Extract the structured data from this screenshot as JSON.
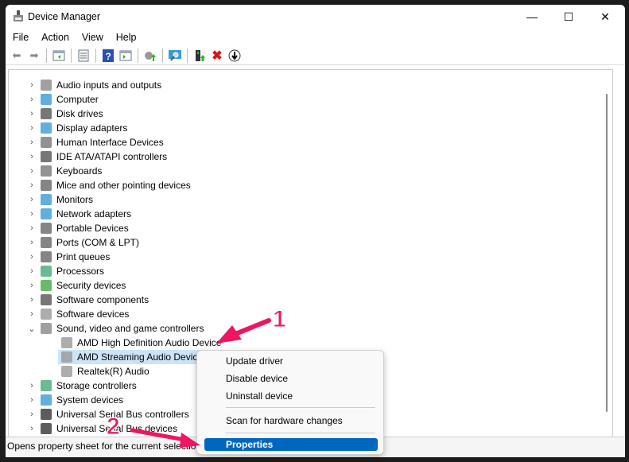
{
  "window": {
    "title": "Device Manager"
  },
  "menu": [
    "File",
    "Action",
    "View",
    "Help"
  ],
  "toolbar": {
    "icons": [
      "back-arrow-icon",
      "forward-arrow-icon",
      "show-hide-console-tree-icon",
      "properties-icon",
      "help-icon",
      "action-pane-icon",
      "update-driver-icon",
      "scan-hardware-icon",
      "enable-device-icon",
      "uninstall-device-icon",
      "disable-device-icon"
    ]
  },
  "tree": {
    "categories": [
      "Audio inputs and outputs",
      "Computer",
      "Disk drives",
      "Display adapters",
      "Human Interface Devices",
      "IDE ATA/ATAPI controllers",
      "Keyboards",
      "Mice and other pointing devices",
      "Monitors",
      "Network adapters",
      "Portable Devices",
      "Ports (COM & LPT)",
      "Print queues",
      "Processors",
      "Security devices",
      "Software components",
      "Software devices",
      "Sound, video and game controllers"
    ],
    "sound_children": [
      "AMD High Definition Audio Device",
      "AMD Streaming Audio Device",
      "Realtek(R) Audio"
    ],
    "after": [
      "Storage controllers",
      "System devices",
      "Universal Serial Bus controllers",
      "Universal Serial Bus devices"
    ],
    "selected": "AMD Streaming Audio Device"
  },
  "context_menu": {
    "items": [
      "Update driver",
      "Disable device",
      "Uninstall device",
      "Scan for hardware changes",
      "Properties"
    ],
    "highlighted": "Properties"
  },
  "status": "Opens property sheet for the current selection.",
  "annotations": {
    "step1": "1",
    "step2": "2",
    "color": "#f01560"
  },
  "colors": {
    "accent": "#0067c0",
    "selection": "#cce4f7"
  }
}
